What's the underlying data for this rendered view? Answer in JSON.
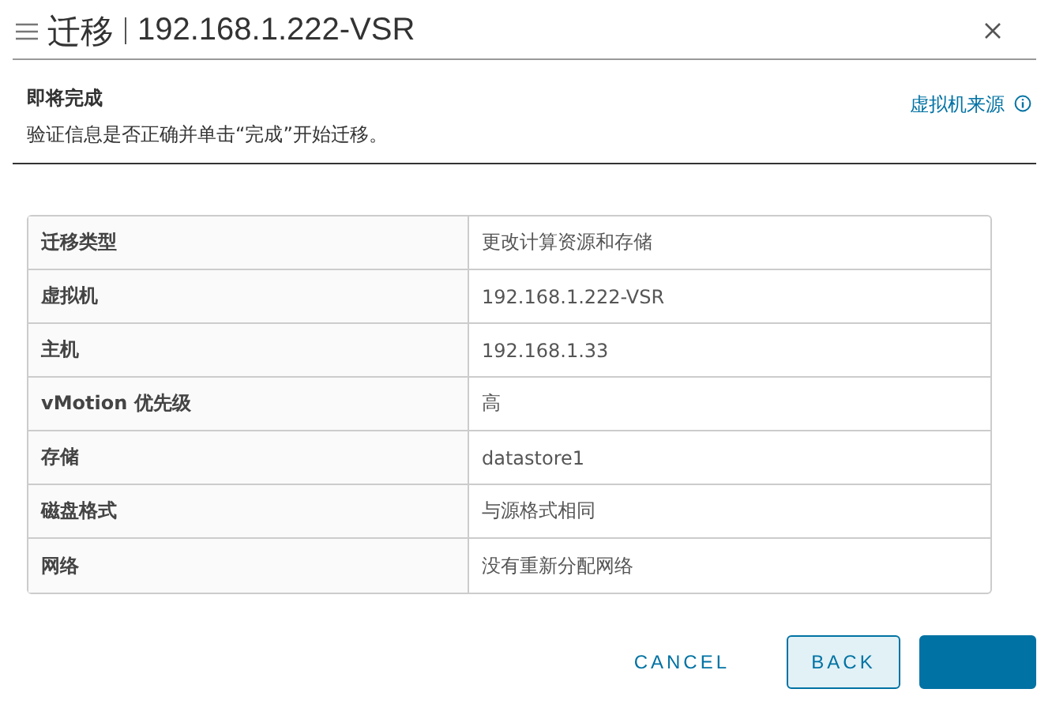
{
  "dialog": {
    "title": "迁移",
    "subtitle": "192.168.1.222-VSR"
  },
  "step": {
    "heading": "即将完成",
    "description": "验证信息是否正确并单击“完成”开始迁移。",
    "link": "虚拟机来源"
  },
  "summary": [
    {
      "label": "迁移类型",
      "value": "更改计算资源和存储"
    },
    {
      "label": "虚拟机",
      "value": "192.168.1.222-VSR"
    },
    {
      "label": "主机",
      "value": "192.168.1.33"
    },
    {
      "label": "vMotion 优先级",
      "value": "高"
    },
    {
      "label": "存储",
      "value": "datastore1"
    },
    {
      "label": "磁盘格式",
      "value": "与源格式相同"
    },
    {
      "label": "网络",
      "value": "没有重新分配网络"
    }
  ],
  "buttons": [
    {
      "kind": "flat",
      "label": "CANCEL"
    },
    {
      "kind": "outline",
      "label": "BACK"
    },
    {
      "kind": "primary"
    }
  ]
}
